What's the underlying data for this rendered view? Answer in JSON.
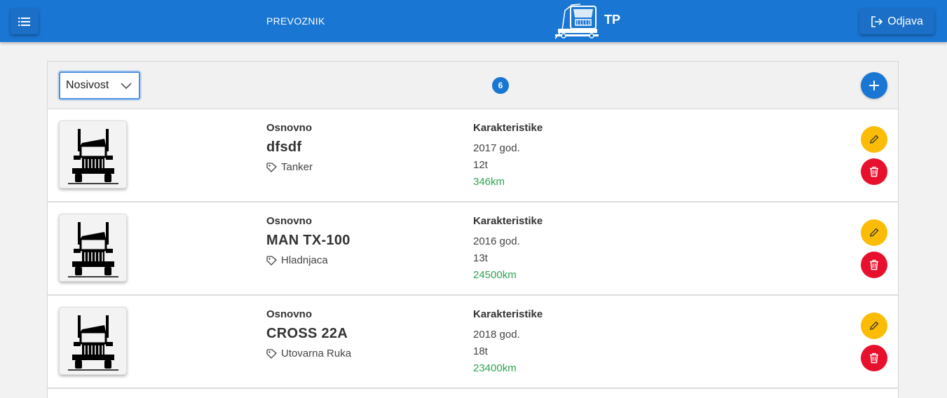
{
  "header": {
    "brand_label": "PREVOZNIK",
    "logo_text": "TP",
    "logout_label": "Odjava",
    "colors": {
      "bar": "#1976d2",
      "text": "#ffffff"
    }
  },
  "toolbar": {
    "sort_select_value": "Nosivost",
    "vehicle_count": "6"
  },
  "vehicles": [
    {
      "section_basic": "Osnovno",
      "name": "dfsdf",
      "type": "Tanker",
      "section_chars": "Karakteristike",
      "year": "2017 god.",
      "capacity": "12t",
      "mileage": "346km"
    },
    {
      "section_basic": "Osnovno",
      "name": "MAN TX-100",
      "type": "Hladnjaca",
      "section_chars": "Karakteristike",
      "year": "2016 god.",
      "capacity": "13t",
      "mileage": "24500km"
    },
    {
      "section_basic": "Osnovno",
      "name": "CROSS 22A",
      "type": "Utovarna Ruka",
      "section_chars": "Karakteristike",
      "year": "2018 god.",
      "capacity": "18t",
      "mileage": "23400km"
    }
  ],
  "icons": {
    "menu": "list-icon",
    "logout": "logout-icon",
    "add": "plus-icon",
    "edit": "pencil-icon",
    "delete": "trash-icon",
    "tag": "tag-icon",
    "truck": "truck-icon"
  },
  "accent_colors": {
    "edit": "#fbbc05",
    "delete": "#e8112d",
    "mileage": "#2ea44f",
    "primary": "#1976d2"
  }
}
